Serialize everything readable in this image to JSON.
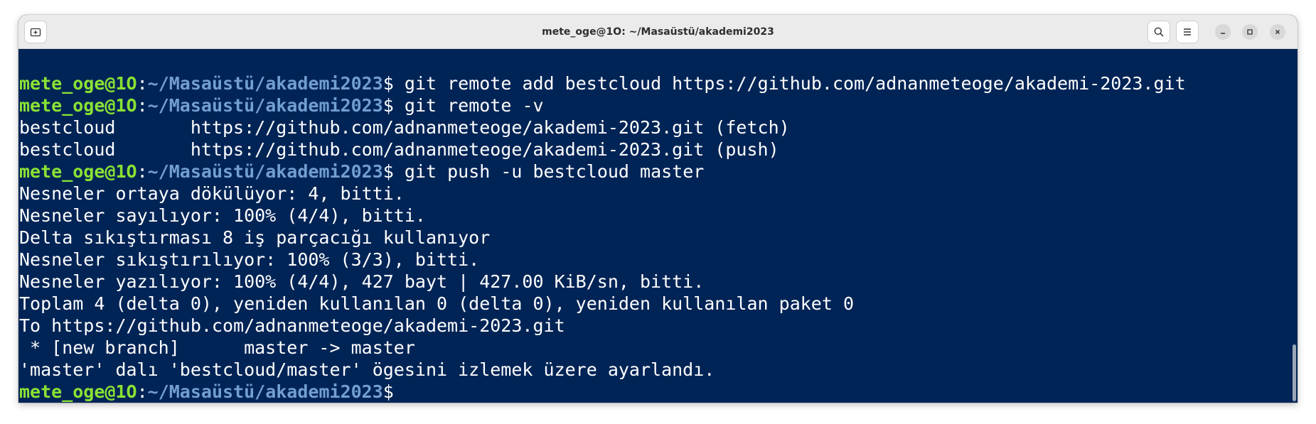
{
  "window": {
    "title": "mete_oge@1O: ~/Masaüstü/akademi2023"
  },
  "titlebar": {
    "new_tab_icon": "new-tab-icon",
    "search_icon": "search-icon",
    "menu_icon": "hamburger-menu-icon",
    "minimize_icon": "minimize-icon",
    "maximize_icon": "maximize-icon",
    "close_icon": "close-icon"
  },
  "colors": {
    "terminal_bg": "#012456",
    "prompt_user": "#8ae234",
    "prompt_path": "#729fcf",
    "text": "#ffffff"
  },
  "terminal": {
    "prompt_user": "mete_oge@1O",
    "prompt_sep": ":",
    "prompt_path": "~/Masaüstü/akademi2023",
    "prompt_sign": "$ ",
    "lines": [
      {
        "type": "cmd",
        "text": "git remote add bestcloud https://github.com/adnanmeteoge/akademi-2023.git"
      },
      {
        "type": "cmd",
        "text": "git remote -v"
      },
      {
        "type": "out",
        "text": "bestcloud\thttps://github.com/adnanmeteoge/akademi-2023.git (fetch)"
      },
      {
        "type": "out",
        "text": "bestcloud\thttps://github.com/adnanmeteoge/akademi-2023.git (push)"
      },
      {
        "type": "cmd",
        "text": "git push -u bestcloud master"
      },
      {
        "type": "out",
        "text": "Nesneler ortaya dökülüyor: 4, bitti."
      },
      {
        "type": "out",
        "text": "Nesneler sayılıyor: 100% (4/4), bitti."
      },
      {
        "type": "out",
        "text": "Delta sıkıştırması 8 iş parçacığı kullanıyor"
      },
      {
        "type": "out",
        "text": "Nesneler sıkıştırılıyor: 100% (3/3), bitti."
      },
      {
        "type": "out",
        "text": "Nesneler yazılıyor: 100% (4/4), 427 bayt | 427.00 KiB/sn, bitti."
      },
      {
        "type": "out",
        "text": "Toplam 4 (delta 0), yeniden kullanılan 0 (delta 0), yeniden kullanılan paket 0"
      },
      {
        "type": "out",
        "text": "To https://github.com/adnanmeteoge/akademi-2023.git"
      },
      {
        "type": "out",
        "text": " * [new branch]      master -> master"
      },
      {
        "type": "out",
        "text": "'master' dalı 'bestcloud/master' ögesini izlemek üzere ayarlandı."
      },
      {
        "type": "cmd",
        "text": ""
      }
    ]
  }
}
